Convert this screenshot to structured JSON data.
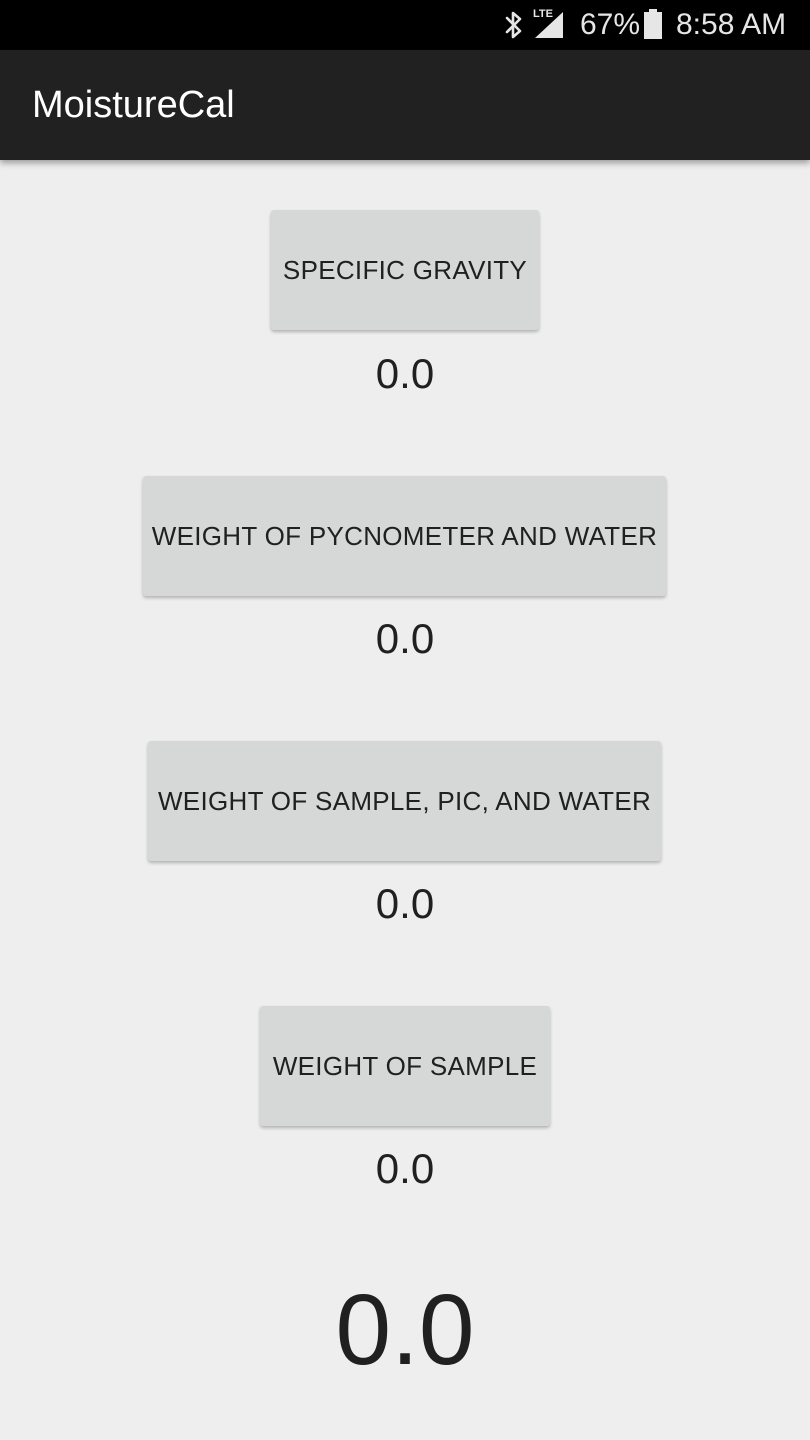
{
  "status_bar": {
    "icons": [
      "bluetooth-icon",
      "lte-icon",
      "cell-signal-icon",
      "battery-icon"
    ],
    "lte_label": "LTE",
    "battery_percent": "67%",
    "time": "8:58 AM"
  },
  "app_bar": {
    "title": "MoistureCal"
  },
  "fields": [
    {
      "button_label": "SPECIFIC GRAVITY",
      "value": "0.0"
    },
    {
      "button_label": "WEIGHT OF PYCNOMETER AND WATER",
      "value": "0.0"
    },
    {
      "button_label": "WEIGHT OF SAMPLE, PIC, AND WATER",
      "value": "0.0"
    },
    {
      "button_label": "WEIGHT OF SAMPLE",
      "value": "0.0"
    }
  ],
  "result": {
    "value": "0.0"
  },
  "colors": {
    "status_bar": "#000000",
    "app_bar": "#212121",
    "background": "#eeeeee",
    "button": "#d6d7d7",
    "text": "#202020"
  }
}
